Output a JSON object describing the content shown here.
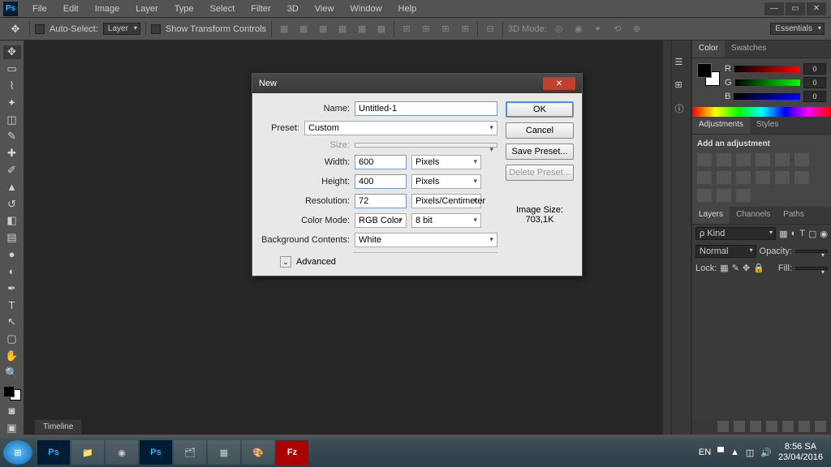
{
  "menu": [
    "File",
    "Edit",
    "Image",
    "Layer",
    "Type",
    "Select",
    "Filter",
    "3D",
    "View",
    "Window",
    "Help"
  ],
  "optbar": {
    "auto_select": "Auto-Select:",
    "target": "Layer",
    "show_transform": "Show Transform Controls",
    "mode_3d": "3D Mode:",
    "workspace": "Essentials"
  },
  "panels": {
    "color": {
      "tab": "Color",
      "swatches": "Swatches",
      "r": "R",
      "g": "G",
      "b": "B",
      "rv": "0",
      "gv": "0",
      "bv": "0"
    },
    "adjustments": {
      "tab": "Adjustments",
      "styles": "Styles",
      "title": "Add an adjustment"
    },
    "layers": {
      "tab": "Layers",
      "channels": "Channels",
      "paths": "Paths",
      "kind": "ρ Kind",
      "normal": "Normal",
      "opacity": "Opacity:",
      "lock": "Lock:",
      "fill": "Fill:"
    }
  },
  "timeline": "Timeline",
  "dialog": {
    "title": "New",
    "name_lbl": "Name:",
    "name_val": "Untitled-1",
    "preset_lbl": "Preset:",
    "preset_val": "Custom",
    "size_lbl": "Size:",
    "width_lbl": "Width:",
    "width_val": "600",
    "width_unit": "Pixels",
    "height_lbl": "Height:",
    "height_val": "400",
    "height_unit": "Pixels",
    "res_lbl": "Resolution:",
    "res_val": "72",
    "res_unit": "Pixels/Centimeter",
    "cmode_lbl": "Color Mode:",
    "cmode_val": "RGB Color",
    "cmode_bits": "8 bit",
    "bg_lbl": "Background Contents:",
    "bg_val": "White",
    "advanced": "Advanced",
    "ok": "OK",
    "cancel": "Cancel",
    "save_preset": "Save Preset...",
    "delete_preset": "Delete Preset...",
    "imgsize_lbl": "Image Size:",
    "imgsize_val": "703,1K"
  },
  "taskbar": {
    "lang": "EN",
    "time": "8:56 SA",
    "date": "23/04/2016"
  }
}
